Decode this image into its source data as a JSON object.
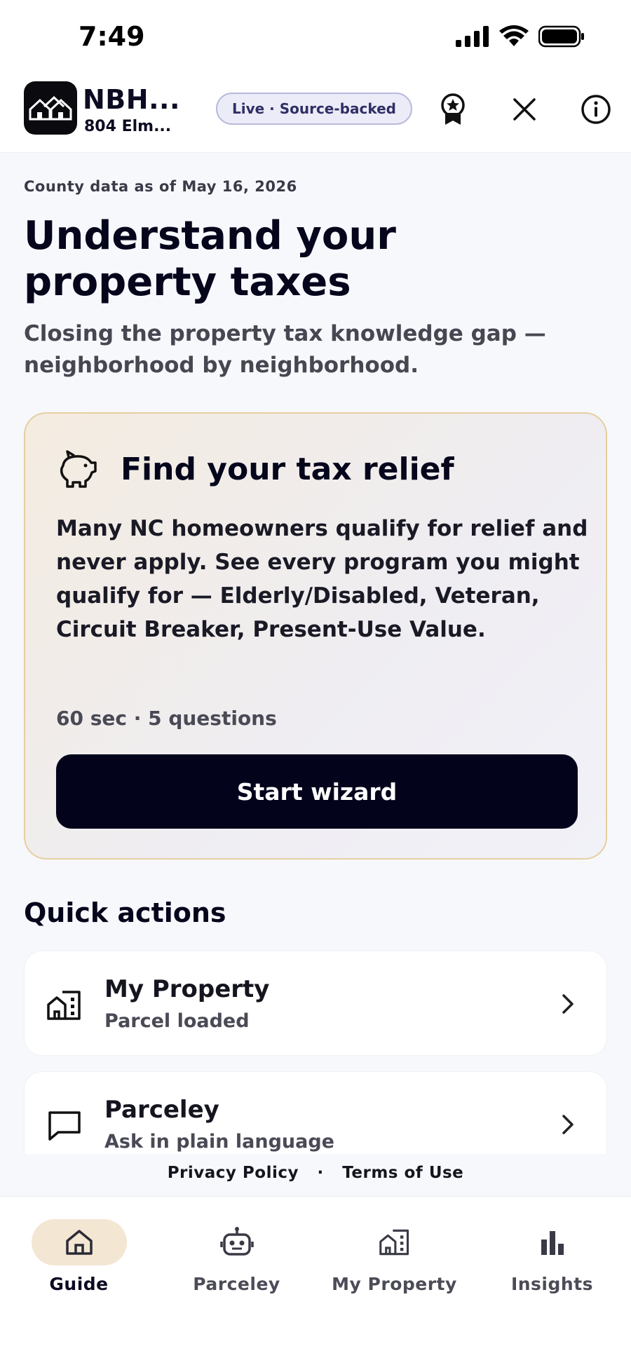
{
  "status_bar": {
    "time": "7:49"
  },
  "app_bar": {
    "app_name": "NBH...",
    "address": "804 Elm...",
    "badge": "Live · Source-backed"
  },
  "hero": {
    "county_date": "County data as of May 16, 2026",
    "title": "Understand your property taxes",
    "subtitle": "Closing the property tax knowledge gap — neighborhood by neighborhood."
  },
  "relief_card": {
    "title": "Find your tax relief",
    "body": "Many NC homeowners qualify for relief and never apply. See every program you might qualify for — Elderly/Disabled, Veteran, Circuit Breaker, Present-Use Value.",
    "meta": "60 sec · 5 questions",
    "button_label": "Start wizard"
  },
  "quick_actions": {
    "title": "Quick actions",
    "items": [
      {
        "title": "My Property",
        "subtitle": "Parcel loaded",
        "icon": "building-icon"
      },
      {
        "title": "Parceley",
        "subtitle": "Ask in plain language",
        "icon": "chat-icon"
      }
    ]
  },
  "footer": {
    "privacy": "Privacy Policy",
    "separator": "·",
    "terms": "Terms of Use"
  },
  "tabs": [
    {
      "label": "Guide",
      "icon": "home-icon",
      "active": true
    },
    {
      "label": "Parceley",
      "icon": "robot-icon",
      "active": false
    },
    {
      "label": "My Property",
      "icon": "building-icon",
      "active": false
    },
    {
      "label": "Insights",
      "icon": "bar-chart-icon",
      "active": false
    }
  ],
  "colors": {
    "accent_dark": "#03031c",
    "card_border": "#e6cfa0",
    "active_tab_bg": "#f3e6d3",
    "badge_bg": "#ececf8"
  }
}
